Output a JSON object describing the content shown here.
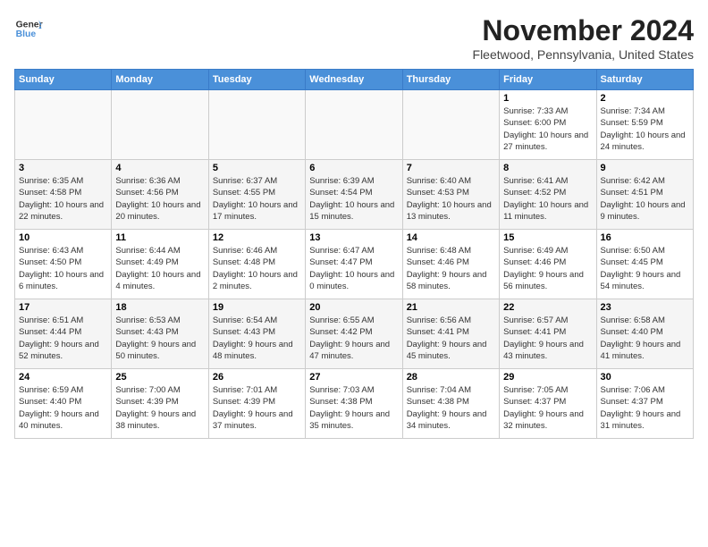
{
  "header": {
    "logo_line1": "General",
    "logo_line2": "Blue",
    "title": "November 2024",
    "subtitle": "Fleetwood, Pennsylvania, United States"
  },
  "days_of_week": [
    "Sunday",
    "Monday",
    "Tuesday",
    "Wednesday",
    "Thursday",
    "Friday",
    "Saturday"
  ],
  "weeks": [
    [
      {
        "num": "",
        "detail": ""
      },
      {
        "num": "",
        "detail": ""
      },
      {
        "num": "",
        "detail": ""
      },
      {
        "num": "",
        "detail": ""
      },
      {
        "num": "",
        "detail": ""
      },
      {
        "num": "1",
        "detail": "Sunrise: 7:33 AM\nSunset: 6:00 PM\nDaylight: 10 hours and 27 minutes."
      },
      {
        "num": "2",
        "detail": "Sunrise: 7:34 AM\nSunset: 5:59 PM\nDaylight: 10 hours and 24 minutes."
      }
    ],
    [
      {
        "num": "3",
        "detail": "Sunrise: 6:35 AM\nSunset: 4:58 PM\nDaylight: 10 hours and 22 minutes."
      },
      {
        "num": "4",
        "detail": "Sunrise: 6:36 AM\nSunset: 4:56 PM\nDaylight: 10 hours and 20 minutes."
      },
      {
        "num": "5",
        "detail": "Sunrise: 6:37 AM\nSunset: 4:55 PM\nDaylight: 10 hours and 17 minutes."
      },
      {
        "num": "6",
        "detail": "Sunrise: 6:39 AM\nSunset: 4:54 PM\nDaylight: 10 hours and 15 minutes."
      },
      {
        "num": "7",
        "detail": "Sunrise: 6:40 AM\nSunset: 4:53 PM\nDaylight: 10 hours and 13 minutes."
      },
      {
        "num": "8",
        "detail": "Sunrise: 6:41 AM\nSunset: 4:52 PM\nDaylight: 10 hours and 11 minutes."
      },
      {
        "num": "9",
        "detail": "Sunrise: 6:42 AM\nSunset: 4:51 PM\nDaylight: 10 hours and 9 minutes."
      }
    ],
    [
      {
        "num": "10",
        "detail": "Sunrise: 6:43 AM\nSunset: 4:50 PM\nDaylight: 10 hours and 6 minutes."
      },
      {
        "num": "11",
        "detail": "Sunrise: 6:44 AM\nSunset: 4:49 PM\nDaylight: 10 hours and 4 minutes."
      },
      {
        "num": "12",
        "detail": "Sunrise: 6:46 AM\nSunset: 4:48 PM\nDaylight: 10 hours and 2 minutes."
      },
      {
        "num": "13",
        "detail": "Sunrise: 6:47 AM\nSunset: 4:47 PM\nDaylight: 10 hours and 0 minutes."
      },
      {
        "num": "14",
        "detail": "Sunrise: 6:48 AM\nSunset: 4:46 PM\nDaylight: 9 hours and 58 minutes."
      },
      {
        "num": "15",
        "detail": "Sunrise: 6:49 AM\nSunset: 4:46 PM\nDaylight: 9 hours and 56 minutes."
      },
      {
        "num": "16",
        "detail": "Sunrise: 6:50 AM\nSunset: 4:45 PM\nDaylight: 9 hours and 54 minutes."
      }
    ],
    [
      {
        "num": "17",
        "detail": "Sunrise: 6:51 AM\nSunset: 4:44 PM\nDaylight: 9 hours and 52 minutes."
      },
      {
        "num": "18",
        "detail": "Sunrise: 6:53 AM\nSunset: 4:43 PM\nDaylight: 9 hours and 50 minutes."
      },
      {
        "num": "19",
        "detail": "Sunrise: 6:54 AM\nSunset: 4:43 PM\nDaylight: 9 hours and 48 minutes."
      },
      {
        "num": "20",
        "detail": "Sunrise: 6:55 AM\nSunset: 4:42 PM\nDaylight: 9 hours and 47 minutes."
      },
      {
        "num": "21",
        "detail": "Sunrise: 6:56 AM\nSunset: 4:41 PM\nDaylight: 9 hours and 45 minutes."
      },
      {
        "num": "22",
        "detail": "Sunrise: 6:57 AM\nSunset: 4:41 PM\nDaylight: 9 hours and 43 minutes."
      },
      {
        "num": "23",
        "detail": "Sunrise: 6:58 AM\nSunset: 4:40 PM\nDaylight: 9 hours and 41 minutes."
      }
    ],
    [
      {
        "num": "24",
        "detail": "Sunrise: 6:59 AM\nSunset: 4:40 PM\nDaylight: 9 hours and 40 minutes."
      },
      {
        "num": "25",
        "detail": "Sunrise: 7:00 AM\nSunset: 4:39 PM\nDaylight: 9 hours and 38 minutes."
      },
      {
        "num": "26",
        "detail": "Sunrise: 7:01 AM\nSunset: 4:39 PM\nDaylight: 9 hours and 37 minutes."
      },
      {
        "num": "27",
        "detail": "Sunrise: 7:03 AM\nSunset: 4:38 PM\nDaylight: 9 hours and 35 minutes."
      },
      {
        "num": "28",
        "detail": "Sunrise: 7:04 AM\nSunset: 4:38 PM\nDaylight: 9 hours and 34 minutes."
      },
      {
        "num": "29",
        "detail": "Sunrise: 7:05 AM\nSunset: 4:37 PM\nDaylight: 9 hours and 32 minutes."
      },
      {
        "num": "30",
        "detail": "Sunrise: 7:06 AM\nSunset: 4:37 PM\nDaylight: 9 hours and 31 minutes."
      }
    ]
  ]
}
